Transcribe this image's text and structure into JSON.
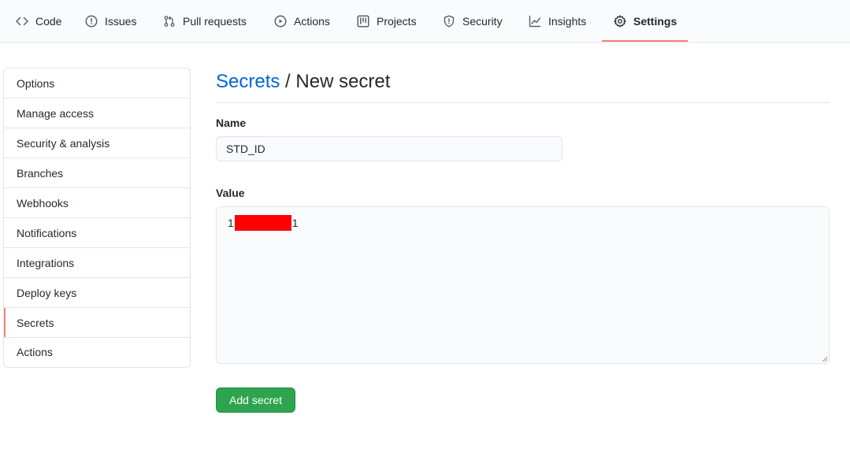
{
  "reponav": {
    "tabs": [
      {
        "label": "Code",
        "icon": "code-icon"
      },
      {
        "label": "Issues",
        "icon": "issue-opened-icon"
      },
      {
        "label": "Pull requests",
        "icon": "git-pull-request-icon"
      },
      {
        "label": "Actions",
        "icon": "play-icon"
      },
      {
        "label": "Projects",
        "icon": "project-icon"
      },
      {
        "label": "Security",
        "icon": "shield-icon"
      },
      {
        "label": "Insights",
        "icon": "graph-icon"
      },
      {
        "label": "Settings",
        "icon": "gear-icon",
        "selected": true
      }
    ],
    "accent": "#f9826c"
  },
  "sidebar": {
    "items": [
      {
        "label": "Options"
      },
      {
        "label": "Manage access"
      },
      {
        "label": "Security & analysis"
      },
      {
        "label": "Branches"
      },
      {
        "label": "Webhooks"
      },
      {
        "label": "Notifications"
      },
      {
        "label": "Integrations"
      },
      {
        "label": "Deploy keys"
      },
      {
        "label": "Secrets",
        "selected": true
      },
      {
        "label": "Actions"
      }
    ]
  },
  "main": {
    "breadcrumb_link": "Secrets",
    "breadcrumb_separator": " / ",
    "breadcrumb_current": "New secret",
    "name_label": "Name",
    "name_value": "STD_ID",
    "value_label": "Value",
    "value_prefix": "1",
    "value_suffix": "1",
    "value_redacted": true,
    "submit_label": "Add secret"
  },
  "colors": {
    "link": "#0366d6",
    "primary_button": "#2ea44f",
    "redaction": "#ff0000"
  }
}
